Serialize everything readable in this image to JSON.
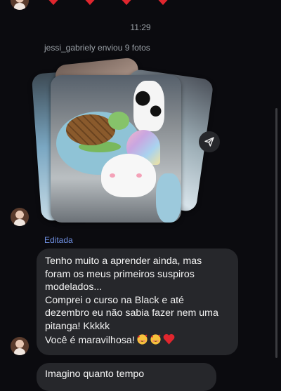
{
  "reactions": {
    "hearts": [
      "heart-icon",
      "heart-icon",
      "heart-icon",
      "heart-icon"
    ],
    "color": "#e0262e"
  },
  "chat": {
    "timestamp": "11:29",
    "sent_note": "jessi_gabriely enviou 9 fotos",
    "edited_label": "Editada",
    "message": "Tenho muito a aprender ainda, mas foram os meus primeiros suspiros modelados...\nComprei o curso na Black e até dezembro eu não sabia fazer nem uma pitanga! Kkkkk\nVocê é maravilhosa!",
    "message_emojis": [
      "smiling-face-with-hearts",
      "smiling-face-with-hearts",
      "red-heart"
    ],
    "next_message_partial": "Imagino quanto tempo"
  },
  "colors": {
    "background": "#0b0b0f",
    "bubble": "#26272b",
    "edited": "#6f8fe0",
    "meta": "#9aa0a6"
  }
}
